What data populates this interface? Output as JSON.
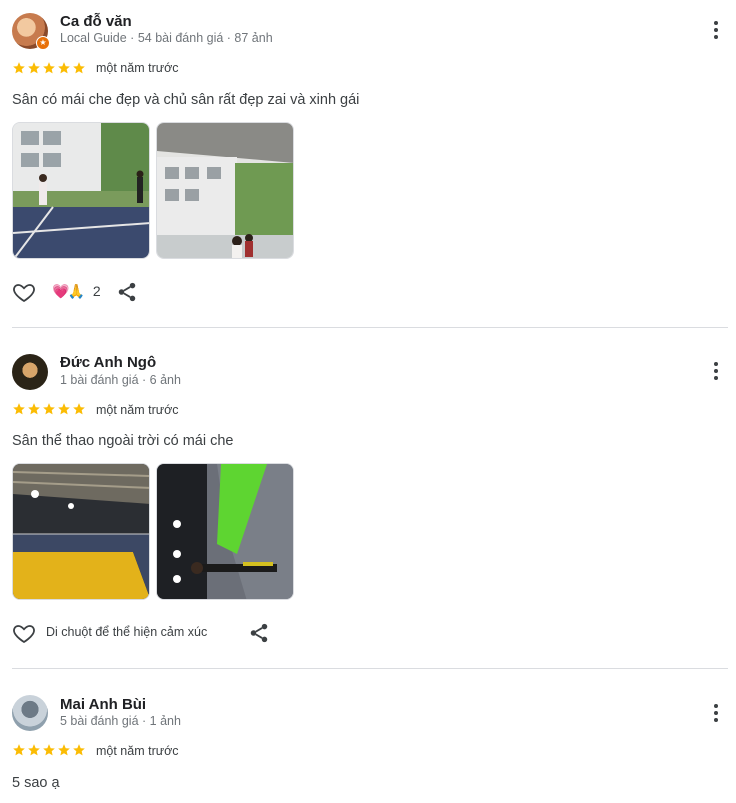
{
  "reviews": [
    {
      "reviewer_name": "Ca đỗ văn",
      "reviewer_meta": "Local Guide · 54 bài đánh giá · 87 ảnh",
      "local_guide": true,
      "rating": 5,
      "time": "một năm trước",
      "text": "Sân có mái che đẹp và chủ sân rất đẹp zai và xinh gái",
      "photos": [
        "outdoor-court-with-players",
        "covered-court-with-building"
      ],
      "reactions": {
        "icons": [
          "heart-eyes-emoji",
          "pray-emoji"
        ],
        "count": "2"
      }
    },
    {
      "reviewer_name": "Đức Anh Ngô",
      "reviewer_meta": "1 bài đánh giá · 6 ảnh",
      "local_guide": false,
      "rating": 5,
      "time": "một năm trước",
      "text": "Sân thể thao ngoài trời có mái che",
      "photos": [
        "covered-court-yellow-floor",
        "green-court-rotated"
      ],
      "hover_hint": "Di chuột để thể hiện cảm xúc"
    },
    {
      "reviewer_name": "Mai Anh Bùi",
      "reviewer_meta": "5 bài đánh giá · 1 ảnh",
      "local_guide": false,
      "rating": 5,
      "time": "một năm trước",
      "text": "5 sao ạ"
    }
  ],
  "colors": {
    "star": "#fbbc04",
    "divider": "#dadce0",
    "meta": "#70757a"
  }
}
